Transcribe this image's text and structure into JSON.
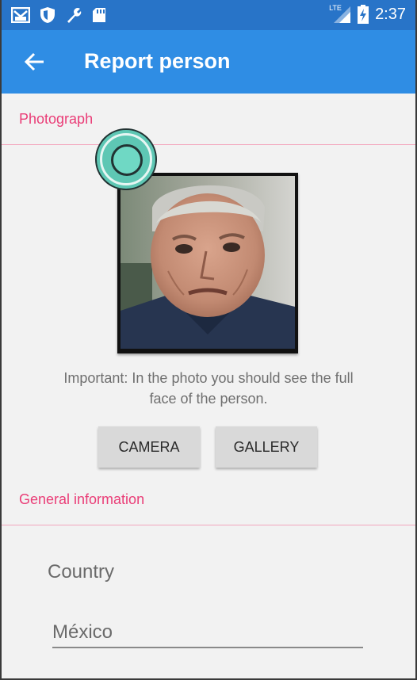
{
  "status_bar": {
    "time": "2:37",
    "network": "LTE",
    "icons": [
      "gmail-icon",
      "shield-icon",
      "wrench-icon",
      "sd-card-icon",
      "signal-icon",
      "battery-charging-icon"
    ]
  },
  "app_bar": {
    "title": "Report person",
    "back_icon": "arrow-back-icon"
  },
  "sections": {
    "photograph": "Photograph",
    "general_information": "General information"
  },
  "photo": {
    "note": "Important: In the photo you should see the full face of the person."
  },
  "buttons": {
    "camera": "CAMERA",
    "gallery": "GALLERY"
  },
  "form": {
    "country_label": "Country",
    "country_value": "México"
  },
  "colors": {
    "status_bar": "#2874c8",
    "app_bar": "#2f8de4",
    "accent": "#ea3d77",
    "divider": "#f3a6bd",
    "button": "#d9d9d9"
  }
}
